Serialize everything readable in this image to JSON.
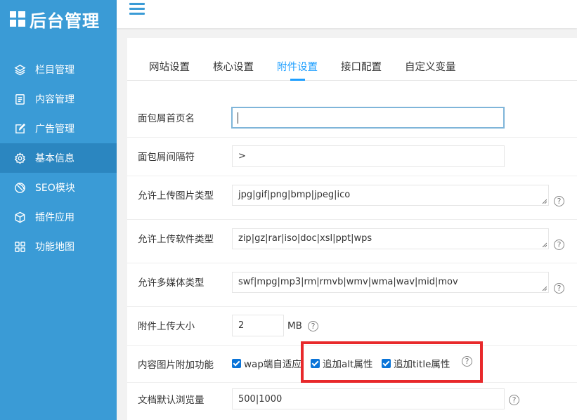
{
  "app": {
    "logo_text": "后台管理"
  },
  "sidebar": {
    "items": [
      {
        "label": "栏目管理",
        "icon": "layers-icon"
      },
      {
        "label": "内容管理",
        "icon": "document-icon"
      },
      {
        "label": "广告管理",
        "icon": "edit-icon"
      },
      {
        "label": "基本信息",
        "icon": "gear-icon",
        "active": true
      },
      {
        "label": "SEO模块",
        "icon": "seo-icon"
      },
      {
        "label": "插件应用",
        "icon": "cube-icon"
      },
      {
        "label": "功能地图",
        "icon": "grid-icon"
      }
    ]
  },
  "tabs": [
    {
      "label": "网站设置"
    },
    {
      "label": "核心设置"
    },
    {
      "label": "附件设置",
      "active": true
    },
    {
      "label": "接口配置"
    },
    {
      "label": "自定义变量"
    }
  ],
  "form": {
    "breadcrumb_home": {
      "label": "面包屑首页名",
      "value": ""
    },
    "breadcrumb_sep": {
      "label": "面包屑间隔符",
      "value": ">"
    },
    "image_types": {
      "label": "允许上传图片类型",
      "value": "jpg|gif|png|bmp|jpeg|ico",
      "help": "?"
    },
    "soft_types": {
      "label": "允许上传软件类型",
      "value": "zip|gz|rar|iso|doc|xsl|ppt|wps",
      "help": "?"
    },
    "media_types": {
      "label": "允许多媒体类型",
      "value": "swf|mpg|mp3|rm|rmvb|wmv|wma|wav|mid|mov",
      "help": "?"
    },
    "upload_size": {
      "label": "附件上传大小",
      "value": "2",
      "unit": "MB",
      "help": "?"
    },
    "image_extra": {
      "label": "内容图片附加功能",
      "options": [
        {
          "label": "wap端自适应",
          "checked": true
        },
        {
          "label": "追加alt属性",
          "checked": true
        },
        {
          "label": "追加title属性",
          "checked": true
        }
      ],
      "help": "?"
    },
    "default_views": {
      "label": "文档默认浏览量",
      "value": "500|1000",
      "help": "?"
    }
  },
  "colors": {
    "sidebar": "#3a9bd6",
    "sidebar_active": "#2b86c0",
    "accent": "#1e9fff",
    "checkbox": "#0a74d8",
    "highlight": "#e8292b"
  }
}
